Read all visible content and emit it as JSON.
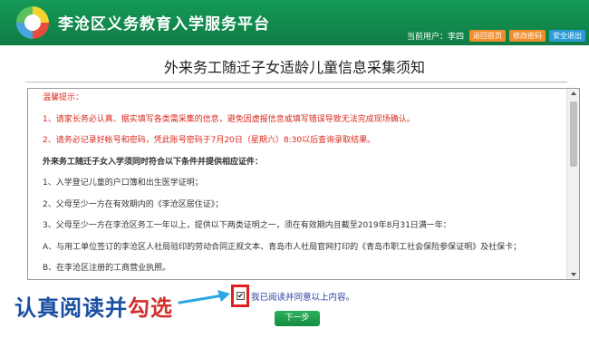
{
  "header": {
    "site_title": "李沧区义务教育入学服务平台",
    "user_text": "当前用户：李四",
    "home_button": "返回首页",
    "change_password_button": "修改密码",
    "logout_button": "安全退出"
  },
  "page": {
    "title": "外来务工随迁子女适龄儿童信息采集须知"
  },
  "notice": {
    "heading": "温馨提示：",
    "tip1": "1、请家长务必认真、据实填写各类需采集的信息，避免因虚报信息或填写错误导致无法完成现场确认。",
    "tip2": "2、请务必记录好帐号和密码，凭此账号密码于7月20日（星期六）8:30以后查询录取结果。",
    "conditions_heading": "外来务工随迁子女入学须同时符合以下条件并提供相应证件：",
    "cond1": "1、入学登记儿童的户口簿和出生医学证明；",
    "cond2": "2、父母至少一方在有效期内的《李沧区居住证》；",
    "cond3": "3、父母至少一方在李沧区务工一年以上，提供以下两类证明之一，须在有效期内且截至2019年8月31日满一年：",
    "cond3a": "A、与用工单位签订的李沧区人社局验印的劳动合同正规文本、青岛市人社局官网打印的《青岛市职工社会保险参保证明》及社保卡；",
    "cond3b": "B、在李沧区注册的工商营业执照。"
  },
  "agreement": {
    "checkbox_mark": "✔",
    "label": "我已阅读并同意以上内容。"
  },
  "next_button": "下一步",
  "annotation": {
    "part1": "认真阅读并",
    "part2": "勾选"
  }
}
